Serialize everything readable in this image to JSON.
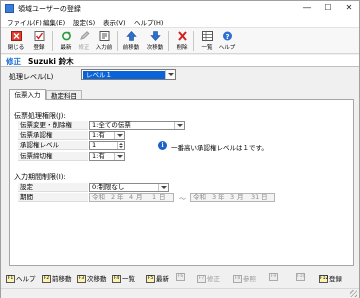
{
  "window": {
    "title": "領域ユーザーの登録",
    "minimize": "—",
    "maximize": "☐",
    "close": "✕"
  },
  "menu": {
    "items": [
      "ファイル(F)",
      "編集(E)",
      "設定(S)",
      "表示(V)",
      "ヘルプ(H)"
    ]
  },
  "toolbar": {
    "buttons": [
      "閉じる",
      "登録",
      "最新",
      "修正",
      "入力前",
      "前移動",
      "次移動",
      "削除",
      "一覧",
      "ヘルプ"
    ]
  },
  "header": {
    "mode": "修正",
    "user": "Suzuki 鈴木"
  },
  "level": {
    "label": "処理レベル(L)",
    "value": "レベル１"
  },
  "tabs": {
    "items": [
      "伝票入力",
      "勘定科目"
    ],
    "active": "伝票入力"
  },
  "slip_processing": {
    "title": "伝票処理権限(J):",
    "rows": [
      {
        "label": "伝票変更・削除権",
        "value": "1:全ての伝票"
      },
      {
        "label": "伝票承認権",
        "value": "1:有"
      },
      {
        "label": "承認権レベル",
        "value": "1"
      },
      {
        "label": "伝票締切権",
        "value": "1:有"
      }
    ],
    "info": "一番高い承認権レベルは１です。"
  },
  "input_period": {
    "title": "入力期間制限(I):",
    "setting_label": "設定",
    "setting_value": "0:制限なし",
    "period_label": "期間",
    "start": {
      "era": "令和",
      "year": "2",
      "year_unit": "年",
      "month": "4",
      "month_unit": "月",
      "day": "1",
      "day_unit": "日"
    },
    "separator": "～",
    "end": {
      "era": "令和",
      "year": "3",
      "year_unit": "年",
      "month": "3",
      "month_unit": "月",
      "day": "31",
      "day_unit": "日"
    }
  },
  "fkeys": [
    {
      "key": "F1",
      "label": "ヘルプ",
      "enabled": true
    },
    {
      "key": "F2",
      "label": "前移動",
      "enabled": true
    },
    {
      "key": "F3",
      "label": "次移動",
      "enabled": true
    },
    {
      "key": "F4",
      "label": "一覧",
      "enabled": true
    },
    {
      "key": "F5",
      "label": "最新",
      "enabled": true
    },
    {
      "key": "F6",
      "label": "",
      "enabled": false
    },
    {
      "key": "F7",
      "label": "修正",
      "enabled": false
    },
    {
      "key": "F8",
      "label": "参照",
      "enabled": false
    },
    {
      "key": "F9",
      "label": "",
      "enabled": false
    },
    {
      "key": "F10",
      "label": "",
      "enabled": false
    },
    {
      "key": "F12",
      "label": "登録",
      "enabled": true
    }
  ],
  "colors": {
    "accent": "#0a64d8",
    "mode": "#1c6fd0"
  }
}
